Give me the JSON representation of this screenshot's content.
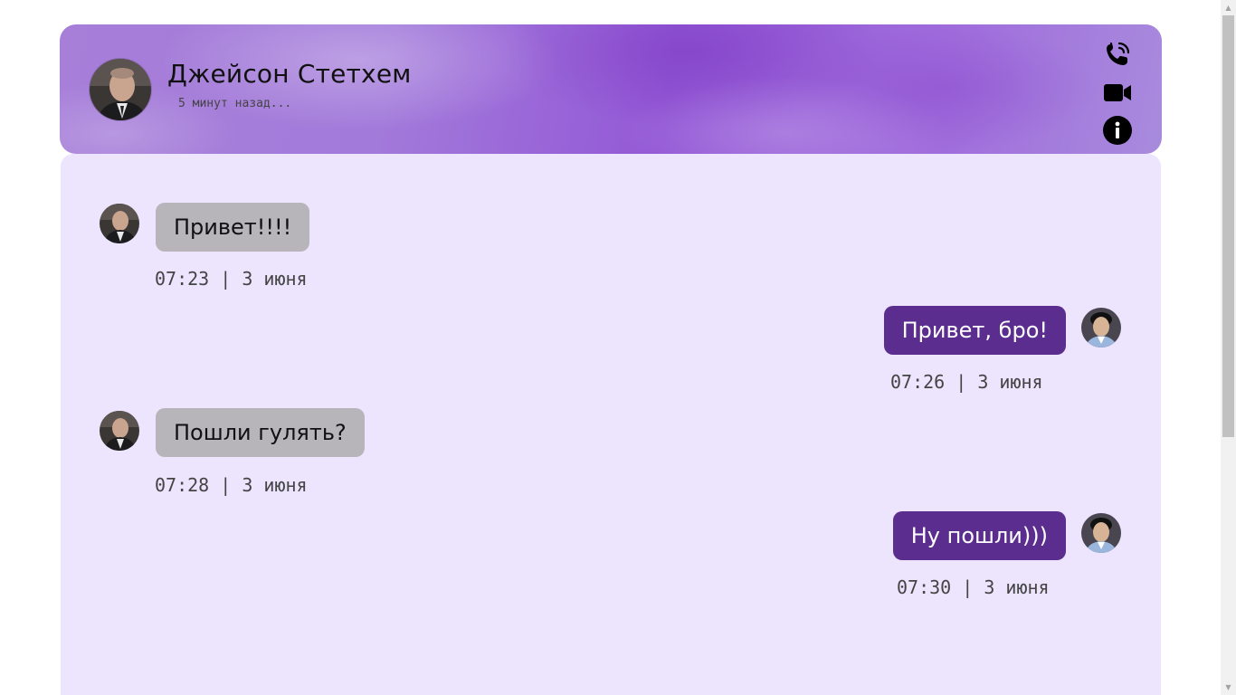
{
  "header": {
    "contact_name": "Джейсон Стетхем",
    "status": "5 минут назад...",
    "actions": [
      "phone-icon",
      "video-camera-icon",
      "info-icon"
    ]
  },
  "colors": {
    "header_bg": "#a06ddc",
    "chat_bg": "#ede4fe",
    "incoming_bubble": "#b7b4ba",
    "outgoing_bubble": "#5b2d8e"
  },
  "messages": [
    {
      "direction": "incoming",
      "text": "Привет!!!!",
      "time": "07:23 | 3 июня"
    },
    {
      "direction": "outgoing",
      "text": "Привет, бро!",
      "time": "07:26 | 3 июня"
    },
    {
      "direction": "incoming",
      "text": "Пошли гулять?",
      "time": "07:28 | 3 июня"
    },
    {
      "direction": "outgoing",
      "text": "Ну пошли)))",
      "time": "07:30 | 3 июня"
    }
  ]
}
